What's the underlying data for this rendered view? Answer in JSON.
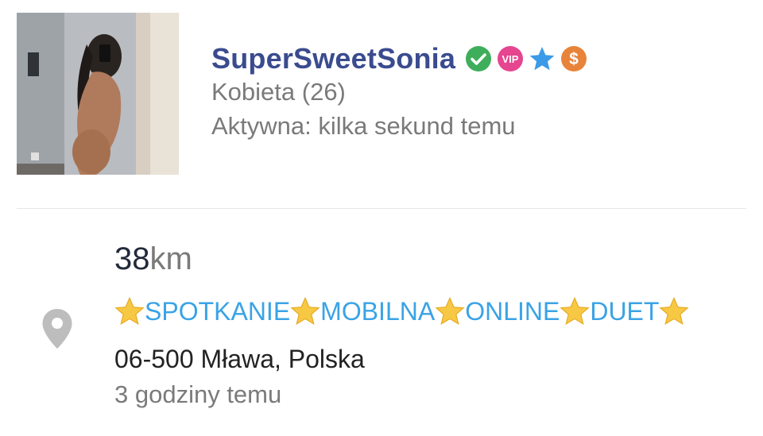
{
  "profile": {
    "username": "SuperSweetSonia",
    "gender_age": "Kobieta (26)",
    "activity": "Aktywna: kilka sekund temu",
    "badges": [
      {
        "icon": "verified-check-icon",
        "color": "#3fae5a"
      },
      {
        "icon": "vip-badge-icon",
        "label": "VIP",
        "color": "#e6458f"
      },
      {
        "icon": "star-icon",
        "color": "#3b9be8"
      },
      {
        "icon": "dollar-icon",
        "label": "$",
        "color": "#e8833a"
      }
    ]
  },
  "listing": {
    "distance_value": "38",
    "distance_unit": "km",
    "tags": [
      "SPOTKANIE",
      "MOBILNA",
      "ONLINE",
      "DUET"
    ],
    "location": "06-500 Mława, Polska",
    "posted": "3 godziny temu",
    "location_icon": "map-pin-icon"
  },
  "colors": {
    "username": "#3a4b8e",
    "tags": "#3aa3e6",
    "secondary_text": "#7a7a7a"
  }
}
